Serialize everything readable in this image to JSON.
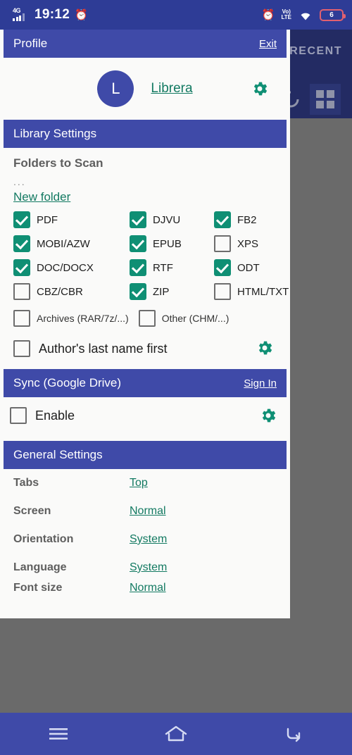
{
  "status_bar": {
    "network": "4G",
    "time": "19:12",
    "alarm_icon": "alarm-clock-icon",
    "volte_top": "Vo)",
    "volte_bottom": "LTE",
    "wifi_icon": "wifi-icon",
    "battery_level": "6"
  },
  "background_app": {
    "tab_label": "RECENT",
    "refresh_icon": "refresh-icon",
    "grid_icon": "grid-view-icon"
  },
  "drawer": {
    "profile": {
      "title": "Profile",
      "exit_label": "Exit",
      "avatar_initial": "L",
      "account_name": "Librera",
      "gear_icon": "gear-icon"
    },
    "library": {
      "title": "Library Settings",
      "folders_label": "Folders to Scan",
      "folders_ellipsis": "...",
      "new_folder_label": "New folder",
      "formats": [
        {
          "label": "PDF",
          "checked": true
        },
        {
          "label": "DJVU",
          "checked": true
        },
        {
          "label": "FB2",
          "checked": true
        },
        {
          "label": "MOBI/AZW",
          "checked": true
        },
        {
          "label": "EPUB",
          "checked": true
        },
        {
          "label": "XPS",
          "checked": false
        },
        {
          "label": "DOC/DOCX",
          "checked": true
        },
        {
          "label": "RTF",
          "checked": true
        },
        {
          "label": "ODT",
          "checked": true
        },
        {
          "label": "CBZ/CBR",
          "checked": false
        },
        {
          "label": "ZIP",
          "checked": true
        },
        {
          "label": "HTML/TXT",
          "checked": false
        }
      ],
      "extras": [
        {
          "label": "Archives (RAR/7z/...)",
          "checked": false
        },
        {
          "label": "Other (CHM/...)",
          "checked": false
        }
      ],
      "author_option": {
        "label": "Author's last name first",
        "checked": false
      },
      "author_gear_icon": "gear-icon"
    },
    "sync": {
      "title": "Sync (Google Drive)",
      "sign_in_label": "Sign In",
      "enable_label": "Enable",
      "enable_checked": false,
      "gear_icon": "gear-icon"
    },
    "general": {
      "title": "General Settings",
      "rows": [
        {
          "key": "Tabs",
          "value": "Top"
        },
        {
          "key": "Screen",
          "value": "Normal"
        },
        {
          "key": "Orientation",
          "value": "System"
        },
        {
          "key": "Language",
          "value": "System"
        },
        {
          "key": "Font size",
          "value": "Normal"
        }
      ]
    }
  },
  "nav_bar": {
    "recents_icon": "menu-icon",
    "home_icon": "home-icon",
    "back_icon": "back-icon"
  },
  "colors": {
    "accent_blue": "#3f4aa8",
    "status_blue": "#2e3c96",
    "link_green": "#137a62",
    "checkbox_green": "#0f8f74",
    "scrim_gray": "#6a6a6a"
  }
}
